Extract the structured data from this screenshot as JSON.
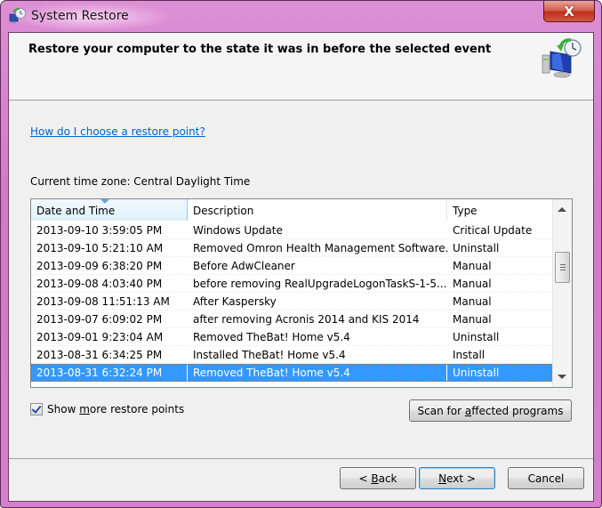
{
  "window": {
    "title": "System Restore",
    "close_label": "X"
  },
  "header": {
    "title": "Restore your computer to the state it was in before the selected event",
    "icon": "system-restore-icon"
  },
  "help_link": "How do I choose a restore point?",
  "timezone": "Current time zone: Central Daylight Time",
  "list": {
    "columns": [
      "Date and Time",
      "Description",
      "Type"
    ],
    "sorted_column": "Date and Time",
    "selected_index": 8,
    "rows": [
      {
        "date": "2013-09-10 3:59:05 PM",
        "description": "Windows Update",
        "type": "Critical Update"
      },
      {
        "date": "2013-09-10 5:21:10 AM",
        "description": "Removed Omron Health Management Software.",
        "type": "Uninstall"
      },
      {
        "date": "2013-09-09 6:38:20 PM",
        "description": "Before AdwCleaner",
        "type": "Manual"
      },
      {
        "date": "2013-09-08 4:03:40 PM",
        "description": "before removing RealUpgradeLogonTaskS-1-5...",
        "type": "Manual"
      },
      {
        "date": "2013-09-08 11:51:13 AM",
        "description": "After Kaspersky",
        "type": "Manual"
      },
      {
        "date": "2013-09-07 6:09:02 PM",
        "description": "after removing Acronis 2014 and KIS 2014",
        "type": "Manual"
      },
      {
        "date": "2013-09-01 9:23:04 AM",
        "description": "Removed TheBat! Home v5.4",
        "type": "Uninstall"
      },
      {
        "date": "2013-08-31 6:34:25 PM",
        "description": "Installed TheBat! Home v5.4",
        "type": "Install"
      },
      {
        "date": "2013-08-31 6:32:24 PM",
        "description": "Removed TheBat! Home v5.4",
        "type": "Uninstall"
      }
    ]
  },
  "show_more": {
    "label_pre": "Show ",
    "label_accel": "m",
    "label_post": "ore restore points",
    "checked": true
  },
  "scan_button": {
    "pre": "Scan for ",
    "accel": "a",
    "post": "ffected programs"
  },
  "back_button": {
    "pre": "< ",
    "accel": "B",
    "post": "ack"
  },
  "next_button": {
    "pre": "",
    "accel": "N",
    "post": "ext >"
  },
  "cancel_button": {
    "label": "Cancel"
  },
  "colors": {
    "selection": "#3399ff",
    "link": "#0066cc",
    "frame": "#d478cb",
    "close": "#c0311d"
  }
}
